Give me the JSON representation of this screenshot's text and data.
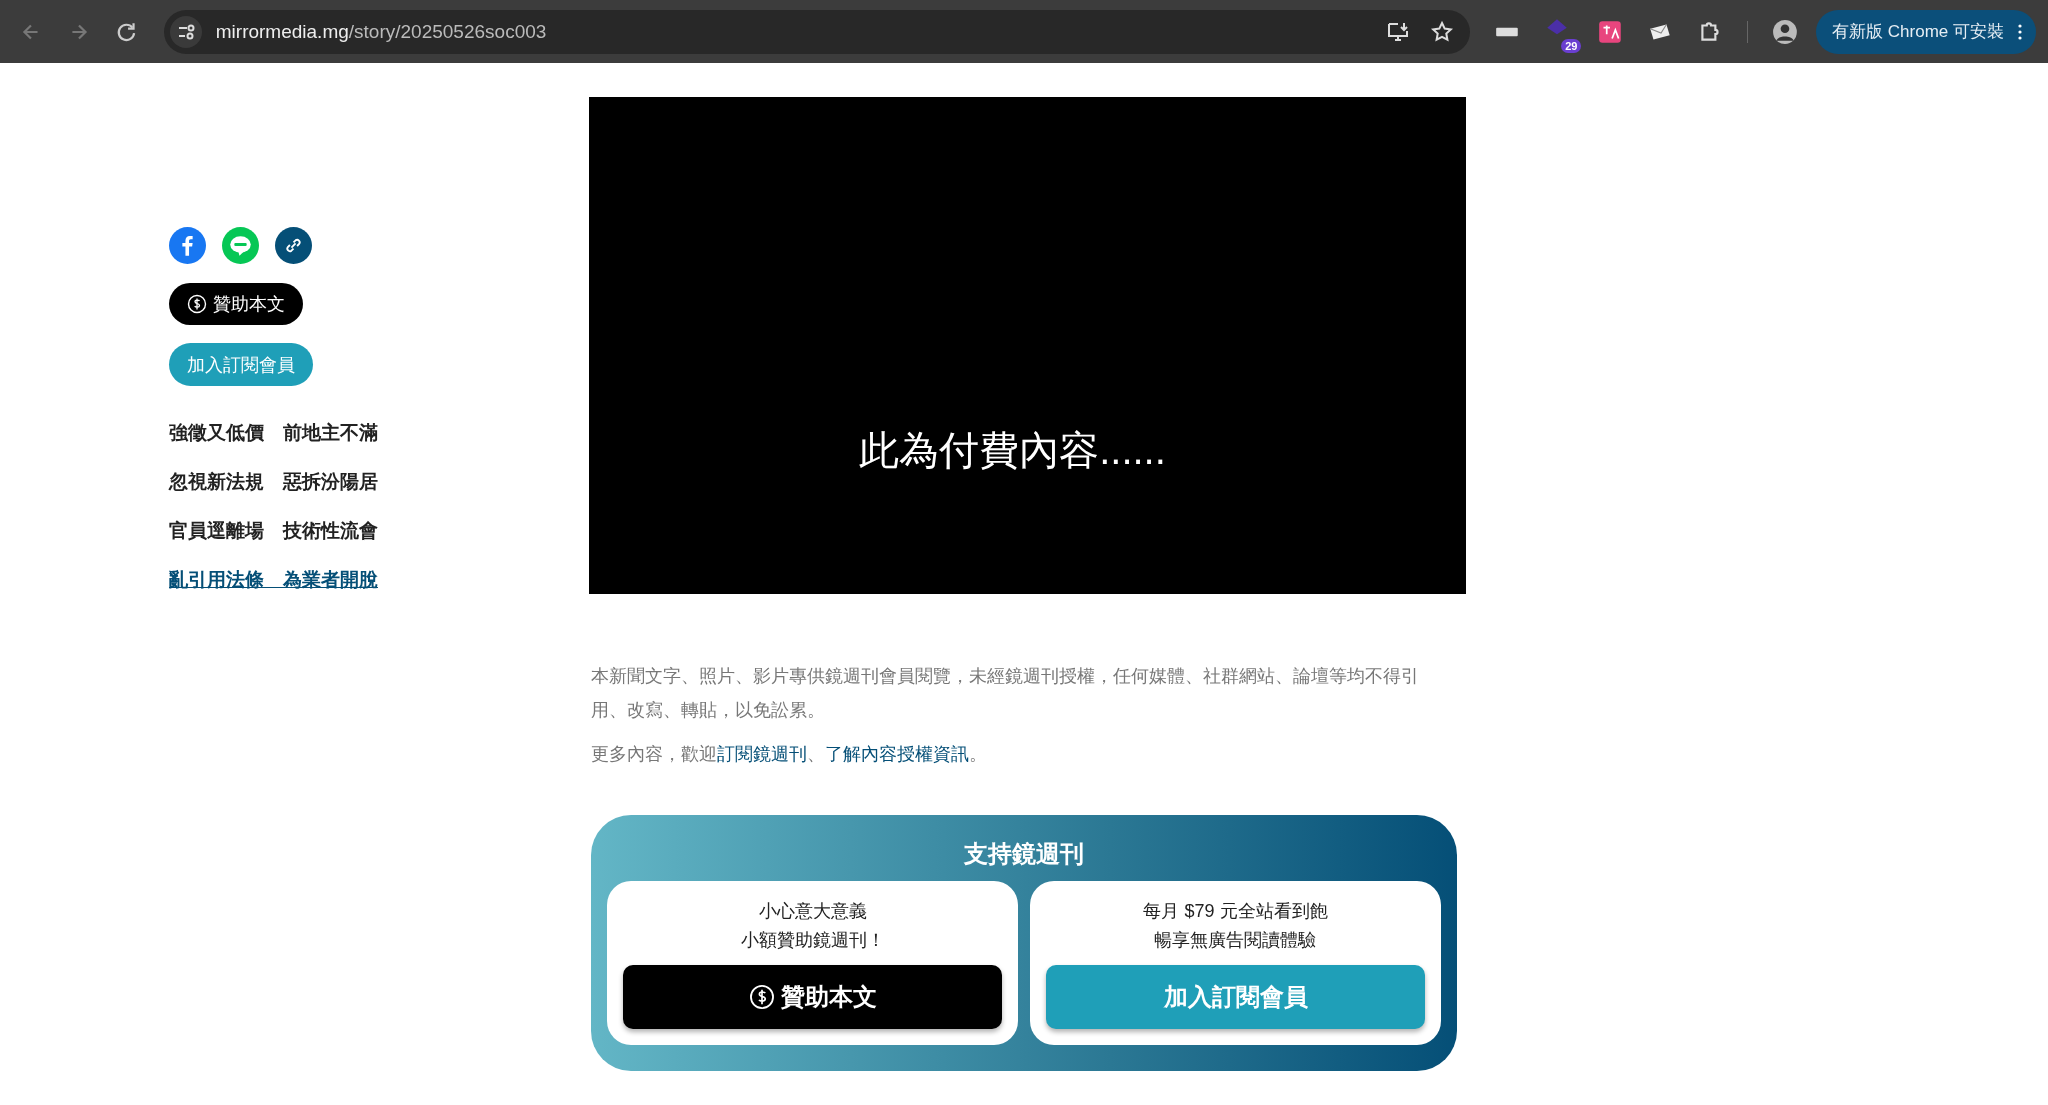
{
  "browser": {
    "url_host": "mirrormedia.mg",
    "url_path": "/story/20250526soc003",
    "extension_badge": "29",
    "update_button": "有新版 Chrome 可安裝"
  },
  "sidebar": {
    "sponsor_button": "贊助本文",
    "subscribe_button": "加入訂閱會員",
    "headlines": [
      {
        "text": "強徵又低價　前地主不滿",
        "kind": "plain"
      },
      {
        "text": "忽視新法規　惡拆汾陽居",
        "kind": "plain"
      },
      {
        "text": "官員逕離場　技術性流會",
        "kind": "plain"
      },
      {
        "text": "亂引用法條　為業者開脫",
        "kind": "link"
      }
    ]
  },
  "paywall": {
    "message": "此為付費內容......"
  },
  "article": {
    "notice": "本新聞文字、照片、影片專供鏡週刊會員閱覽，未經鏡週刊授權，任何媒體、社群網站、論壇等均不得引用、改寫、轉貼，以免訟累。",
    "more": [
      {
        "text": "更多內容，歡迎",
        "kind": "plain"
      },
      {
        "text": "訂閱鏡週刊",
        "kind": "link"
      },
      {
        "text": "、",
        "kind": "plain"
      },
      {
        "text": "了解內容授權資訊",
        "kind": "link"
      },
      {
        "text": "。",
        "kind": "plain"
      }
    ]
  },
  "support": {
    "title": "支持鏡週刊",
    "cards": [
      {
        "kind": "sponsor",
        "lines": [
          "小心意大意義",
          "小額贊助鏡週刊！"
        ],
        "button": "贊助本文"
      },
      {
        "kind": "subscribe",
        "lines": [
          "每月 $79 元全站看到飽",
          "暢享無廣告閱讀體驗"
        ],
        "button": "加入訂閱會員"
      }
    ]
  }
}
